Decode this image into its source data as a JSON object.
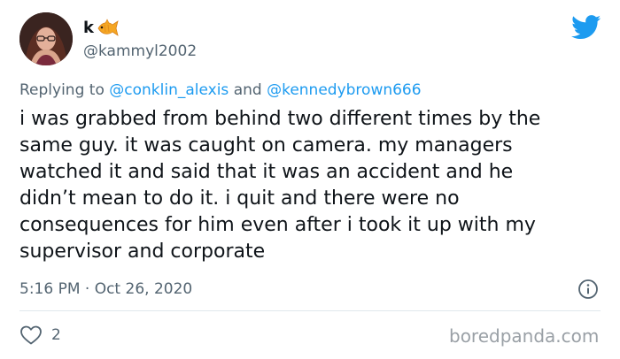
{
  "tweet": {
    "author": {
      "display_name": "k",
      "name_emoji_icon": "fish-icon",
      "handle": "@kammyl2002"
    },
    "reply_context": {
      "prefix": "Replying to",
      "mention_1": "@conklin_alexis",
      "connector": "and",
      "mention_2": "@kennedybrown666"
    },
    "text_lines": [
      "i was grabbed from behind two different times by the",
      "same guy. it was caught on camera. my managers",
      "watched it and said that it was an accident and he",
      "didn’t mean to do it. i quit and there were no",
      "consequences for him even after i took it up with my",
      "supervisor and corporate"
    ],
    "timestamp": "5:16 PM · Oct 26, 2020",
    "like_count": "2",
    "brand_icon": "twitter-bird-icon",
    "info_icon": "info-icon",
    "like_icon": "heart-icon"
  },
  "watermark": "boredpanda.com",
  "colors": {
    "text_primary": "#0f1419",
    "text_secondary": "#536471",
    "accent": "#1d9bf0",
    "divider": "#e1e8ed",
    "watermark": "#9aa0a6"
  }
}
